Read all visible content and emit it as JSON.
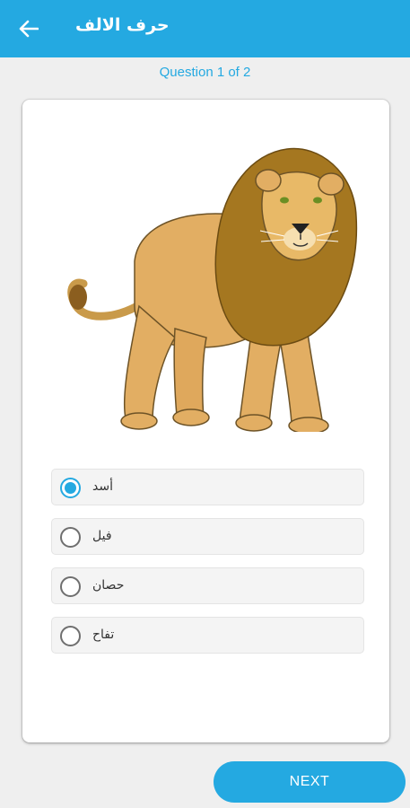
{
  "app": {
    "title": "حرف الالف",
    "back_icon": "arrow-left-icon"
  },
  "quiz": {
    "progress_text": "Question 1 of 2",
    "image_subject": "lion",
    "options": [
      {
        "label": "أسد",
        "selected": true
      },
      {
        "label": "فيل",
        "selected": false
      },
      {
        "label": "حصان",
        "selected": false
      },
      {
        "label": "تفاح",
        "selected": false
      }
    ],
    "next_label": "NEXT"
  },
  "colors": {
    "accent": "#24a9e1",
    "background": "#efefef",
    "card": "#ffffff"
  }
}
